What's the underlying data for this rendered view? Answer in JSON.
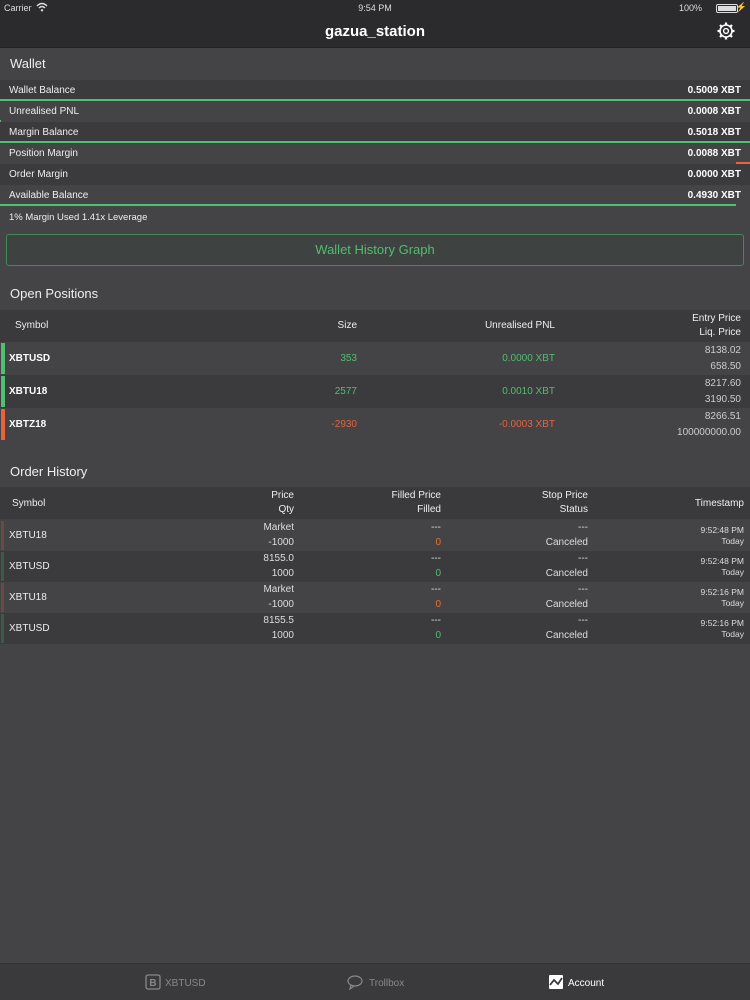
{
  "status_bar": {
    "carrier": "Carrier",
    "time": "9:54 PM",
    "battery": "100%"
  },
  "nav": {
    "title": "gazua_station"
  },
  "wallet": {
    "title": "Wallet",
    "rows": [
      {
        "label": "Wallet Balance",
        "value": "0.5009 XBT"
      },
      {
        "label": "Unrealised PNL",
        "value": "0.0008 XBT"
      },
      {
        "label": "Margin Balance",
        "value": "0.5018 XBT"
      },
      {
        "label": "Position Margin",
        "value": "0.0088 XBT"
      },
      {
        "label": "Order Margin",
        "value": "0.0000 XBT"
      },
      {
        "label": "Available Balance",
        "value": "0.4930 XBT"
      }
    ],
    "margin_info": "1% Margin Used 1.41x Leverage",
    "graph_button": "Wallet History Graph",
    "colors": {
      "green": "#4fbf70",
      "red": "#e8623a"
    }
  },
  "positions": {
    "title": "Open Positions",
    "headers": {
      "symbol": "Symbol",
      "size": "Size",
      "pnl": "Unrealised PNL",
      "entry": "Entry Price",
      "liq": "Liq. Price"
    },
    "rows": [
      {
        "symbol": "XBTUSD",
        "size": "353",
        "pnl": "0.0000 XBT",
        "entry": "8138.02",
        "liq": "658.50",
        "side": "long"
      },
      {
        "symbol": "XBTU18",
        "size": "2577",
        "pnl": "0.0010 XBT",
        "entry": "8217.60",
        "liq": "3190.50",
        "side": "long"
      },
      {
        "symbol": "XBTZ18",
        "size": "-2930",
        "pnl": "-0.0003 XBT",
        "entry": "8266.51",
        "liq": "100000000.00",
        "side": "short"
      }
    ]
  },
  "orders": {
    "title": "Order History",
    "headers": {
      "symbol": "Symbol",
      "price": "Price",
      "qty": "Qty",
      "filled_price": "Filled Price",
      "filled": "Filled",
      "stop_price": "Stop Price",
      "status": "Status",
      "timestamp": "Timestamp"
    },
    "rows": [
      {
        "symbol": "XBTU18",
        "price": "Market",
        "qty": "-1000",
        "filled_price": "---",
        "filled": "0",
        "stop_price": "---",
        "status": "Canceled",
        "time": "9:52:48 PM",
        "day": "Today",
        "side": "sell"
      },
      {
        "symbol": "XBTUSD",
        "price": "8155.0",
        "qty": "1000",
        "filled_price": "---",
        "filled": "0",
        "stop_price": "---",
        "status": "Canceled",
        "time": "9:52:48 PM",
        "day": "Today",
        "side": "buy"
      },
      {
        "symbol": "XBTU18",
        "price": "Market",
        "qty": "-1000",
        "filled_price": "---",
        "filled": "0",
        "stop_price": "---",
        "status": "Canceled",
        "time": "9:52:16 PM",
        "day": "Today",
        "side": "sell"
      },
      {
        "symbol": "XBTUSD",
        "price": "8155.5",
        "qty": "1000",
        "filled_price": "---",
        "filled": "0",
        "stop_price": "---",
        "status": "Canceled",
        "time": "9:52:16 PM",
        "day": "Today",
        "side": "buy"
      }
    ]
  },
  "tabs": [
    {
      "label": "XBTUSD",
      "icon": "bitcoin-icon",
      "active": false
    },
    {
      "label": "Trollbox",
      "icon": "chat-icon",
      "active": false
    },
    {
      "label": "Account",
      "icon": "chart-icon",
      "active": true
    }
  ]
}
